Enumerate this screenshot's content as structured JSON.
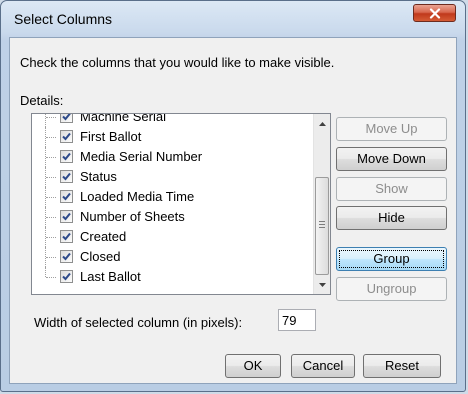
{
  "dialog": {
    "title": "Select Columns",
    "instruction": "Check the columns that you would like to make visible.",
    "details_label": "Details:",
    "columns": [
      {
        "label": "Machine Serial",
        "checked": true
      },
      {
        "label": "First Ballot",
        "checked": true
      },
      {
        "label": "Media Serial Number",
        "checked": true
      },
      {
        "label": "Status",
        "checked": true
      },
      {
        "label": "Loaded Media Time",
        "checked": true
      },
      {
        "label": "Number of Sheets",
        "checked": true
      },
      {
        "label": "Created",
        "checked": true
      },
      {
        "label": "Closed",
        "checked": true
      },
      {
        "label": "Last Ballot",
        "checked": true
      }
    ],
    "buttons": {
      "move_up": "Move Up",
      "move_down": "Move Down",
      "show": "Show",
      "hide": "Hide",
      "group": "Group",
      "ungroup": "Ungroup",
      "ok": "OK",
      "cancel": "Cancel",
      "reset": "Reset"
    },
    "width_label": "Width of selected column (in pixels):",
    "width_value": "79"
  },
  "icons": {
    "close": "close-icon",
    "checkmark": "checkmark-icon",
    "scroll_up": "scroll-up-arrow-icon",
    "scroll_down": "scroll-down-arrow-icon"
  },
  "colors": {
    "close_button": "#c0391c",
    "checkmark": "#2d4a8a",
    "focused_button": "#bee6fd"
  }
}
